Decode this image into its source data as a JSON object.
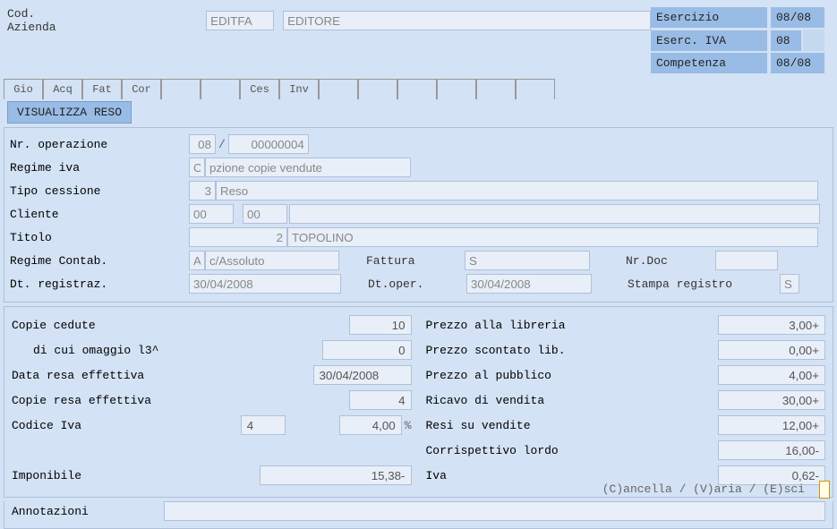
{
  "header": {
    "cod_az_label": "Cod. Azienda",
    "cod_az_val": "EDITFA",
    "cod_az_desc": "EDITORE",
    "esercizio_label": "Esercizio",
    "esercizio_val": "08/08",
    "eserc_iva_label": "Eserc. IVA",
    "eserc_iva_val": "08",
    "competenza_label": "Competenza",
    "competenza_val": "08/08"
  },
  "tabs": {
    "t0": "Gio",
    "t1": "Acq",
    "t2": "Fat",
    "t3": "Cor",
    "t4": "",
    "t5": "",
    "t6": "Ces",
    "t7": "Inv",
    "t8": "",
    "t9": "",
    "t10": "",
    "t11": "",
    "t12": "",
    "t13": ""
  },
  "subtab": "VISUALIZZA RESO",
  "form": {
    "nr_op_label": "Nr. operazione",
    "nr_op_a": "08",
    "nr_op_b": "00000004",
    "regime_iva_label": "Regime iva",
    "regime_iva_code": "O",
    "regime_iva_desc": "pzione copie vendute",
    "tipo_cess_label": "Tipo cessione",
    "tipo_cess_code": "3",
    "tipo_cess_desc": "Reso",
    "cliente_label": "Cliente",
    "cliente_a": "00",
    "cliente_b": "00",
    "titolo_label": "Titolo",
    "titolo_code": "2",
    "titolo_desc": "TOPOLINO",
    "regime_cont_label": "Regime Contab.",
    "regime_cont_code": "A",
    "regime_cont_desc": "c/Assoluto",
    "fattura_label": "Fattura",
    "fattura_val": "S",
    "nrdoc_label": "Nr.Doc",
    "nrdoc_val": "",
    "dt_reg_label": "Dt. registraz.",
    "dt_reg_val": "30/04/2008",
    "dt_oper_label": "Dt.oper.",
    "dt_oper_val": "30/04/2008",
    "stampa_label": "Stampa registro",
    "stampa_val": "S"
  },
  "panel": {
    "copie_cedute_label": "Copie cedute",
    "copie_cedute_val": "10",
    "omaggio_label": "di cui omaggio l3^",
    "omaggio_val": "0",
    "data_resa_label": "Data resa effettiva",
    "data_resa_val": "30/04/2008",
    "copie_resa_label": "Copie resa effettiva",
    "copie_resa_val": "4",
    "codice_iva_label": "Codice Iva",
    "codice_iva_code": "4",
    "codice_iva_pct": "4,00",
    "imponibile_label": "Imponibile",
    "imponibile_val": "15,38-",
    "annot_label": "Annotazioni",
    "annot_val": "",
    "prezzo_lib_label": "Prezzo alla libreria",
    "prezzo_lib_val": "3,00+",
    "prezzo_scont_label": "Prezzo scontato lib.",
    "prezzo_scont_val": "0,00+",
    "prezzo_pub_label": "Prezzo al pubblico",
    "prezzo_pub_val": "4,00+",
    "ricavo_label": "Ricavo di vendita",
    "ricavo_val": "30,00+",
    "resi_label": "Resi su vendite",
    "resi_val": "12,00+",
    "corrisp_label": "Corrispettivo lordo",
    "corrisp_val": "16,00-",
    "iva_label": "Iva",
    "iva_val": "0,62-"
  },
  "footer": {
    "actions": "(C)ancella / (V)aria / (E)sci"
  },
  "pct_sign": "%",
  "slash": "/"
}
